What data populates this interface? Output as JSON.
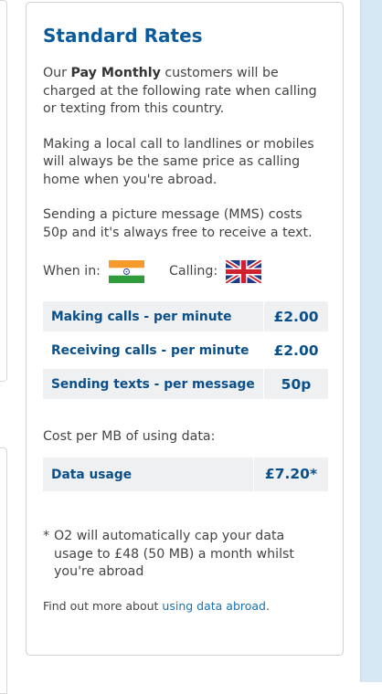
{
  "panel": {
    "title": "Standard Rates",
    "intro_prefix": "Our ",
    "intro_bold": "Pay Monthly",
    "intro_suffix": " customers will be charged at the following rate when calling or texting from this country.",
    "local_call_text": "Making a local call to landlines or mobiles will always be the same price as calling home when you're abroad.",
    "mms_text": "Sending a picture message (MMS) costs 50p and it's always free to receive a text.",
    "when_in_label": "When in:",
    "when_in_flag": "india-flag-icon",
    "calling_label": "Calling:",
    "calling_flag": "uk-flag-icon",
    "rates": [
      {
        "name": "Making calls - per minute",
        "price": "£2.00"
      },
      {
        "name": "Receiving calls - per minute",
        "price": "£2.00"
      },
      {
        "name": "Sending texts - per message",
        "price": "50p"
      }
    ],
    "data_label": "Cost per MB of using data:",
    "data_row": {
      "name": "Data usage",
      "price": "£7.20*"
    },
    "footnote_star": "*",
    "footnote_text": "O2 will automatically cap your data usage to £48 (50 MB) a month whilst you're abroad",
    "more_prefix": "Find out more about ",
    "more_link": "using data abroad",
    "more_suffix": "."
  },
  "colors": {
    "title": "#0b5b9c",
    "table_text": "#0b4f8a",
    "link": "#1673b4",
    "row_shade": "#eef0f2",
    "right_stripe": "#d5e8f3"
  }
}
